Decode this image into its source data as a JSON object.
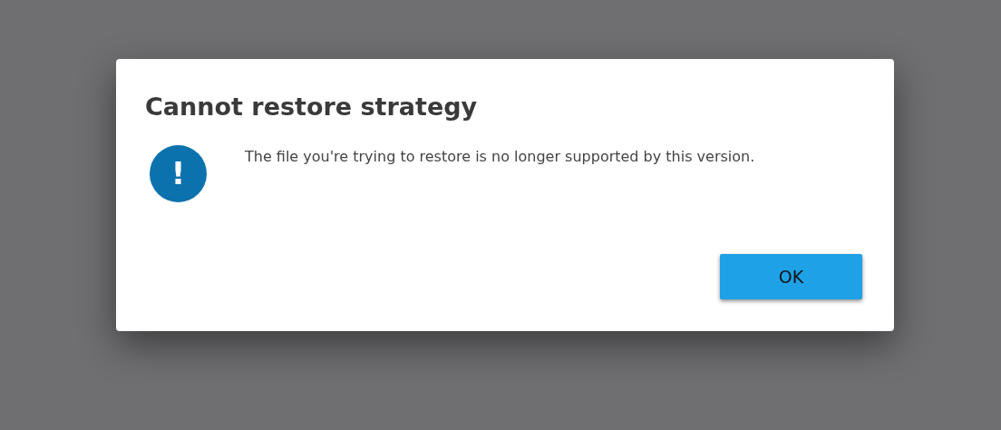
{
  "dialog": {
    "title": "Cannot restore strategy",
    "message": "The file you're trying to restore is no longer supported by this version.",
    "icon_glyph": "!",
    "buttons": [
      "OK"
    ]
  }
}
